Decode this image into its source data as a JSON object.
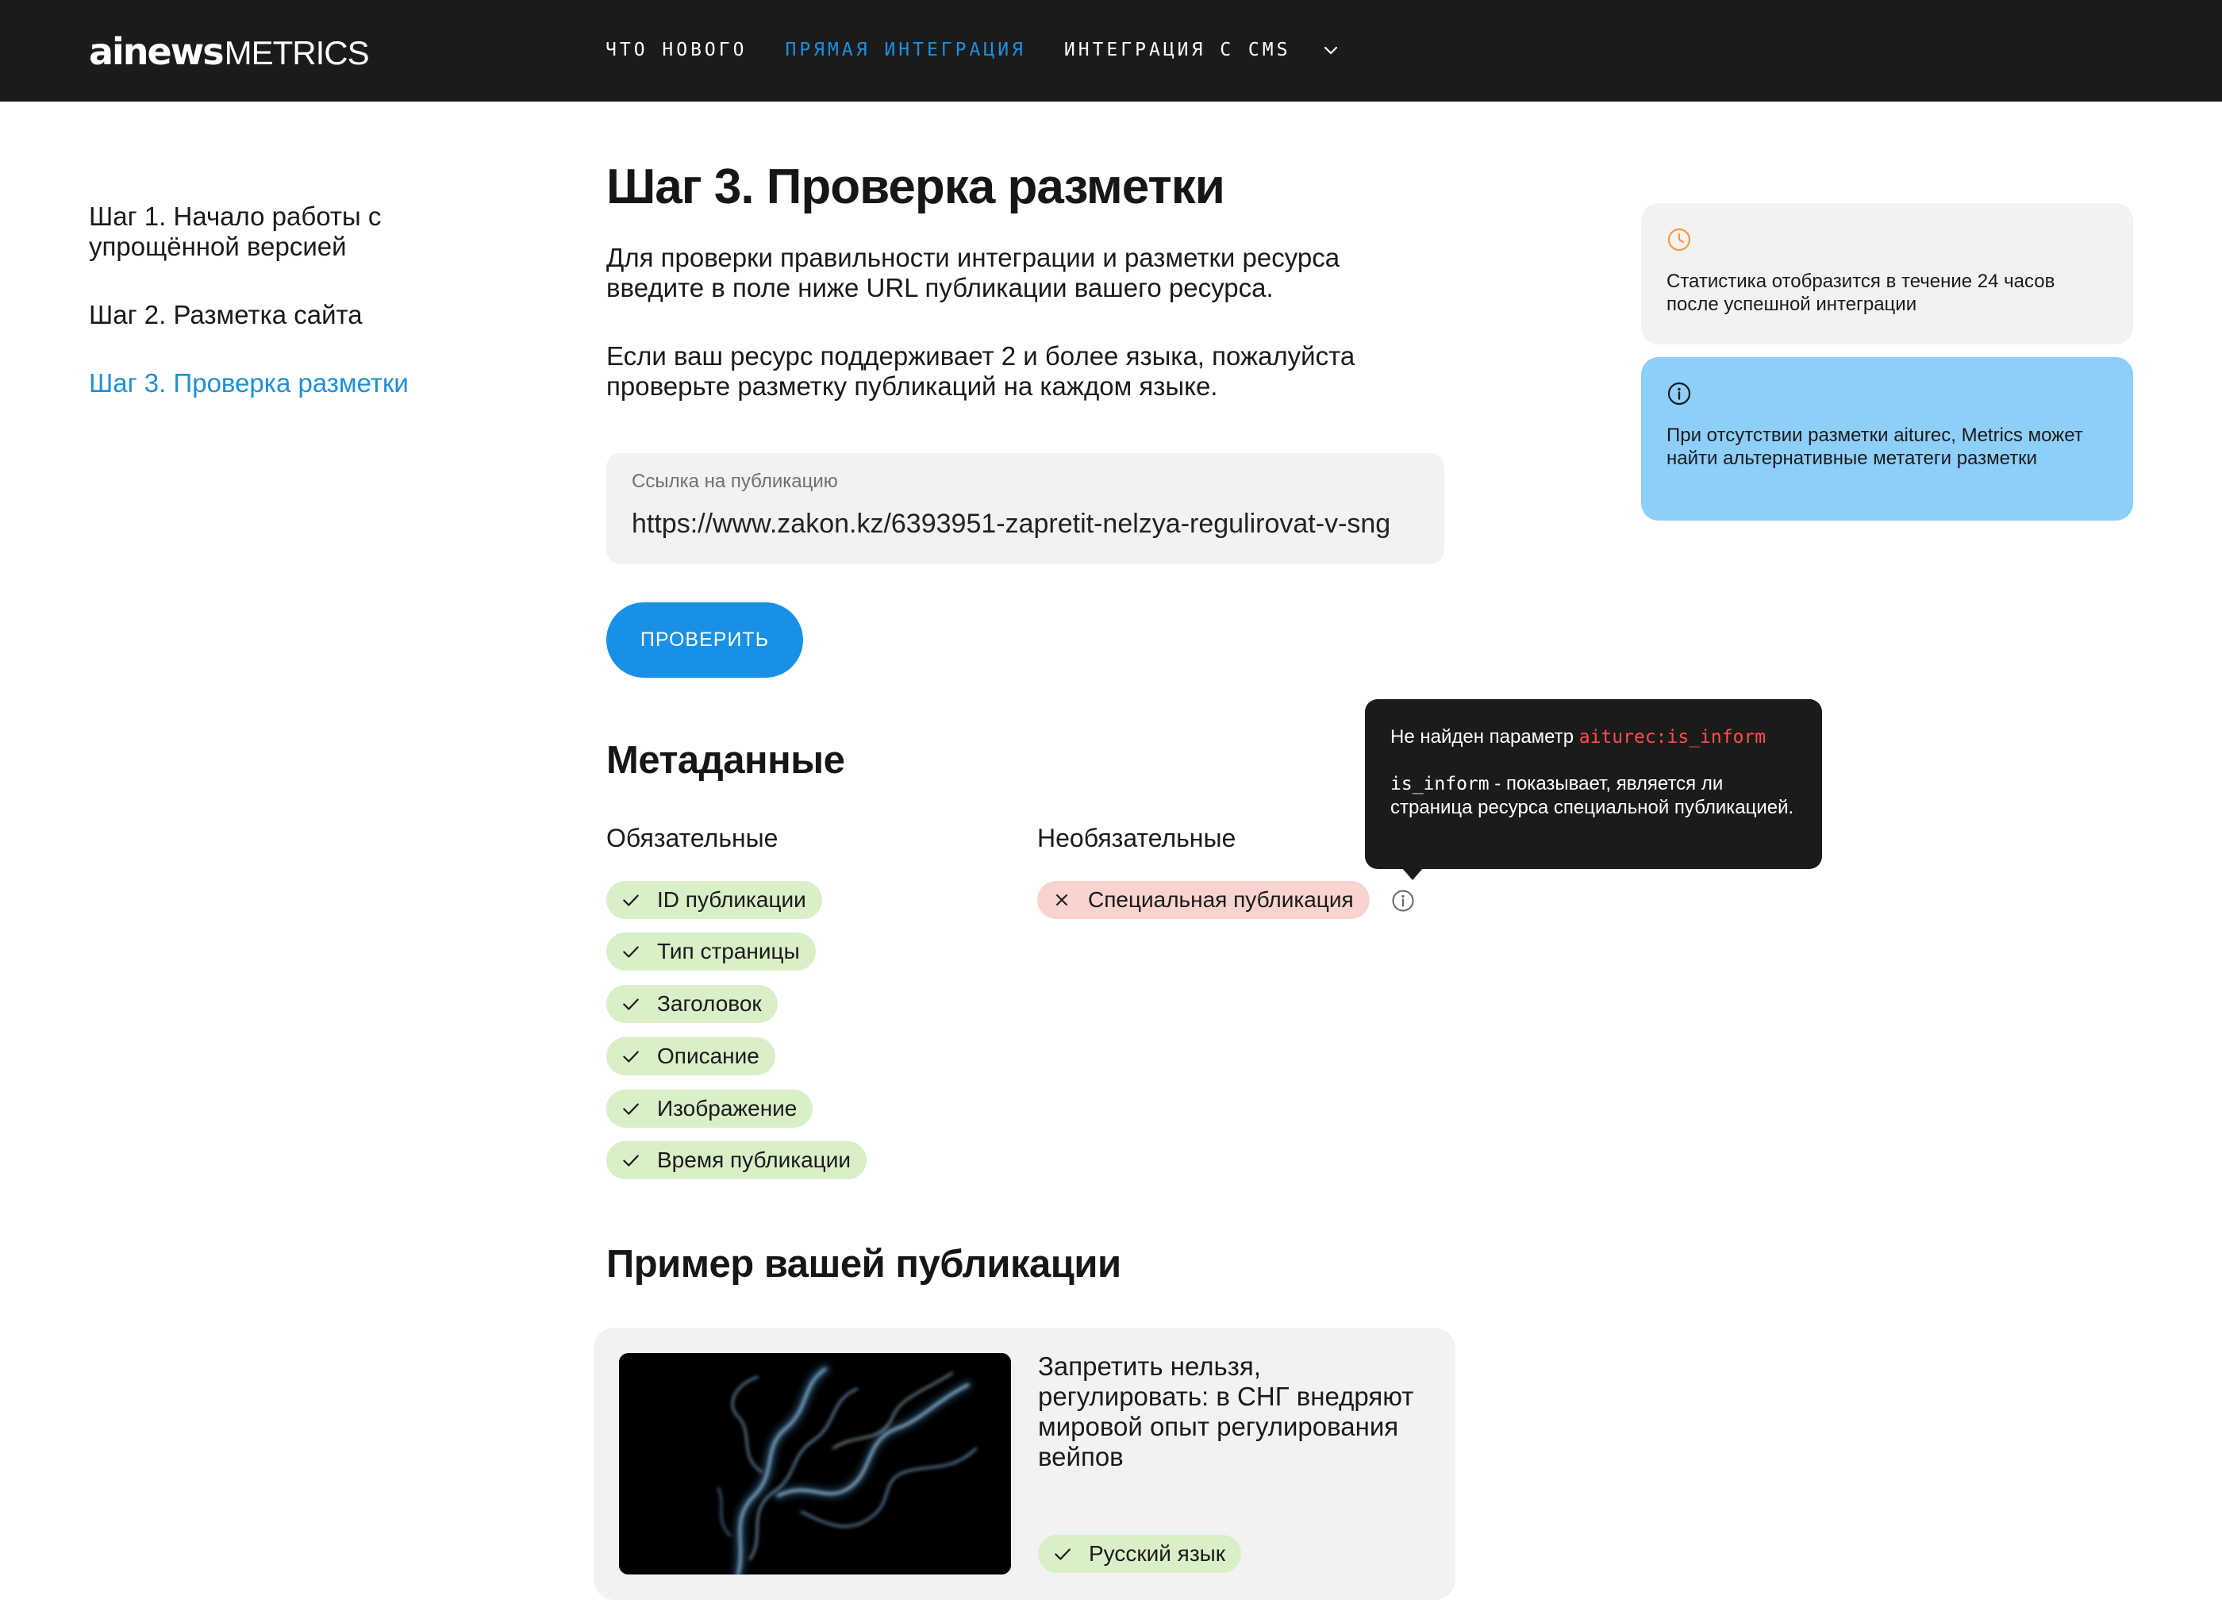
{
  "header": {
    "logo_ai": "ainews",
    "logo_metrics": "METRICS",
    "nav": [
      {
        "label": "ЧТО НОВОГО",
        "active": false
      },
      {
        "label": "ПРЯМАЯ ИНТЕГРАЦИЯ",
        "active": true
      },
      {
        "label": "ИНТЕГРАЦИЯ С CMS",
        "active": false
      }
    ],
    "nav_dropdown_icon": "chevron-down-icon"
  },
  "sidebar": {
    "items": [
      {
        "label": "Шаг 1. Начало работы с упрощённой версией",
        "active": false
      },
      {
        "label": "Шаг 2. Разметка сайта",
        "active": false
      },
      {
        "label": "Шаг 3. Проверка разметки",
        "active": true
      }
    ]
  },
  "main": {
    "title": "Шаг 3. Проверка разметки",
    "paragraph1": "Для проверки правильности интеграции и разметки ресурса введите в поле ниже URL публикации вашего ресурса.",
    "paragraph2": "Если ваш ресурс поддерживает 2 и более языка, пожалуйста проверьте разметку публикаций на каждом языке.",
    "url_field": {
      "label": "Ссылка на публикацию",
      "value": "https://www.zakon.kz/6393951-zapretit-nelzya-regulirovat-v-sng"
    },
    "check_button": "ПРОВЕРИТЬ"
  },
  "metadata": {
    "title": "Метаданные",
    "required_label": "Обязательные",
    "optional_label": "Необязательные",
    "required": [
      "ID публикации",
      "Тип страницы",
      "Заголовок",
      "Описание",
      "Изображение",
      "Время публикации"
    ],
    "optional": [
      "Специальная публикация"
    ]
  },
  "tooltip": {
    "prefix": "Не найден параметр ",
    "param": "aiturec:is_inform",
    "code": "is_inform",
    "desc": " - показывает, является ли страница ресурса специальной публикацией."
  },
  "cards": {
    "stats": "Статистика отобразится в течение 24 часов после успешной интеграции",
    "alt": "При отсутствии разметки aiturec, Metrics может найти альтернативные метатеги разметки"
  },
  "example": {
    "title": "Пример вашей публикации",
    "pub_title": "Запретить нельзя, регулировать: в СНГ внедряют мировой опыт регулирования вейпов",
    "language": "Русский язык"
  },
  "colors": {
    "header_bg": "#1b1b1b",
    "accent": "#1e90e0",
    "ok_tag": "#d9efc7",
    "bad_tag": "#f9d3cd",
    "info_blue": "#8ecffa",
    "warn_orange": "#f29a3f",
    "code_red": "#ff4d4d"
  }
}
